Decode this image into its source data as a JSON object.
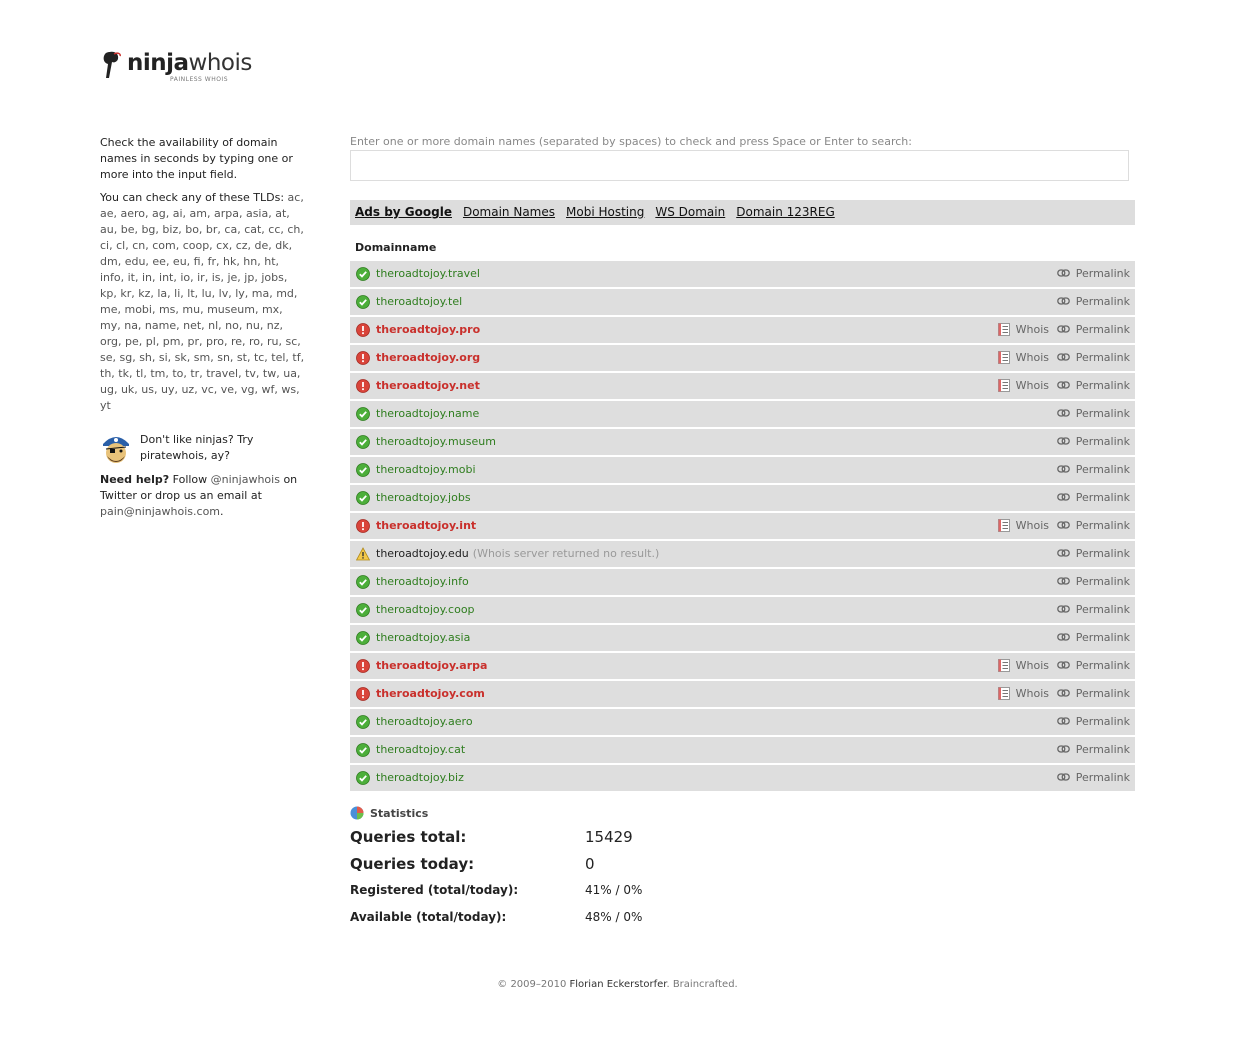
{
  "logo": {
    "bold": "ninja",
    "light": "whois",
    "tagline": "PAINLESS WHOIS"
  },
  "sidebar": {
    "intro": "Check the availability of domain names in seconds by typing one or more into the input field.",
    "tlds_intro": "You can check any of these TLDs:",
    "tlds": "ac, ae, aero, ag, ai, am, arpa, asia, at, au, be, bg, biz, bo, br, ca, cat, cc, ch, ci, cl, cn, com, coop, cx, cz, de, dk, dm, edu, ee, eu, fi, fr, hk, hn, ht, info, it, in, int, io, ir, is, je, jp, jobs, kp, kr, kz, la, li, lt, lu, lv, ly, ma, md, me, mobi, ms, mu, museum, mx, my, na, name, net, nl, no, nu, nz, org, pe, pl, pm, pr, pro, re, ro, ru, sc, se, sg, sh, si, sk, sm, sn, st, tc, tel, tf, th, tk, tl, tm, to, tr, travel, tv, tw, ua, ug, uk, us, uy, uz, vc, ve, vg, wf, ws, yt",
    "pirate_text": "Don't like ninjas? Try",
    "pirate_link": "piratewhois",
    "pirate_suffix": ", ay?",
    "help_bold": "Need help?",
    "help_text1": " Follow ",
    "help_twitter": "@ninjawhois",
    "help_text2": " on Twitter or drop us an email at ",
    "help_email": "pain@ninjawhois.com",
    "help_end": "."
  },
  "search": {
    "label": "Enter one or more domain names (separated by spaces) to check and press Space or Enter to search:",
    "value": ""
  },
  "ads": [
    "Ads by Google",
    "Domain Names",
    "Mobi Hosting",
    "WS Domain",
    "Domain 123REG"
  ],
  "table": {
    "header": "Domainname",
    "whois_label": "Whois",
    "permalink_label": "Permalink",
    "rows": [
      {
        "domain": "theroadtojoy.travel",
        "status": "free"
      },
      {
        "domain": "theroadtojoy.tel",
        "status": "free"
      },
      {
        "domain": "theroadtojoy.pro",
        "status": "taken"
      },
      {
        "domain": "theroadtojoy.org",
        "status": "taken"
      },
      {
        "domain": "theroadtojoy.net",
        "status": "taken"
      },
      {
        "domain": "theroadtojoy.name",
        "status": "free"
      },
      {
        "domain": "theroadtojoy.museum",
        "status": "free"
      },
      {
        "domain": "theroadtojoy.mobi",
        "status": "free"
      },
      {
        "domain": "theroadtojoy.jobs",
        "status": "free"
      },
      {
        "domain": "theroadtojoy.int",
        "status": "taken"
      },
      {
        "domain": "theroadtojoy.edu",
        "status": "warn",
        "note": "(Whois server returned no result.)"
      },
      {
        "domain": "theroadtojoy.info",
        "status": "free"
      },
      {
        "domain": "theroadtojoy.coop",
        "status": "free"
      },
      {
        "domain": "theroadtojoy.asia",
        "status": "free"
      },
      {
        "domain": "theroadtojoy.arpa",
        "status": "taken"
      },
      {
        "domain": "theroadtojoy.com",
        "status": "taken"
      },
      {
        "domain": "theroadtojoy.aero",
        "status": "free"
      },
      {
        "domain": "theroadtojoy.cat",
        "status": "free"
      },
      {
        "domain": "theroadtojoy.biz",
        "status": "free"
      }
    ]
  },
  "stats": {
    "title": "Statistics",
    "queries_total_label": "Queries total:",
    "queries_total": "15429",
    "queries_today_label": "Queries today:",
    "queries_today": "0",
    "registered_label": "Registered (total/today):",
    "registered": "41% / 0%",
    "available_label": "Available (total/today):",
    "available": "48% / 0%"
  },
  "footer": {
    "prefix": "© 2009–2010 ",
    "author": "Florian Eckerstorfer",
    "suffix": ". Braincrafted."
  },
  "colors": {
    "free": "#2e7d1e",
    "taken": "#c9302c",
    "row_bg": "#dedede"
  }
}
